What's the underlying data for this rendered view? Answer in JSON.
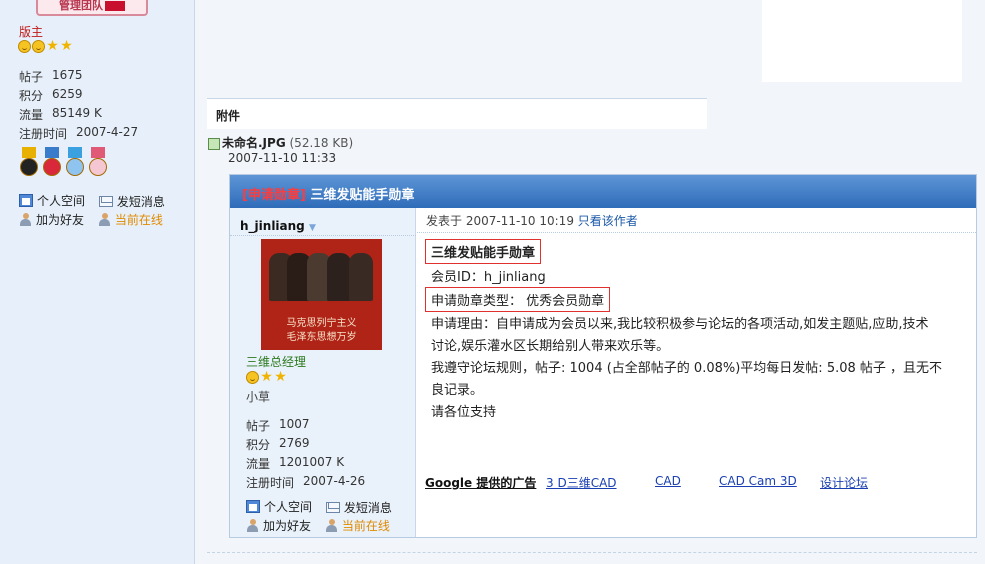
{
  "left_profile": {
    "team_banner": "管理团队",
    "rank": "版主",
    "stats": [
      {
        "label": "帖子",
        "value": "1675"
      },
      {
        "label": "积分",
        "value": "6259"
      },
      {
        "label": "流量",
        "value": "85149 K"
      },
      {
        "label": "注册时间",
        "value": "2007-4-27"
      }
    ],
    "links": {
      "space": "个人空间",
      "message": "发短消息",
      "add_friend": "加为好友",
      "online": "当前在线"
    }
  },
  "attachment": {
    "heading": "附件",
    "file_name": "未命名.JPG",
    "file_size": "(52.18 KB)",
    "file_date": "2007-11-10 11:33"
  },
  "post_image": {
    "title_tag": "[申请勋章]",
    "title": " 三维发贴能手勋章",
    "author": {
      "name": "h_jinliang",
      "avatar_caption_1": "马克思列宁主义",
      "avatar_caption_2": "毛泽东思想万岁",
      "rank": "三维总经理",
      "sub_rank": "小草",
      "stats": [
        {
          "label": "帖子",
          "value": "1007"
        },
        {
          "label": "积分",
          "value": "2769"
        },
        {
          "label": "流量",
          "value": "1201007 K"
        },
        {
          "label": "注册时间",
          "value": "2007-4-26"
        }
      ],
      "links": {
        "space": "个人空间",
        "message": "发短消息",
        "add_friend": "加为好友",
        "online": "当前在线"
      }
    },
    "meta": {
      "posted_at": "发表于 2007-11-10 10:19",
      "only_author": "只看该作者"
    },
    "body": {
      "heading": "三维发贴能手勋章",
      "member_id": "会员ID：h_jinliang",
      "medal_type": "申请勋章类型： 优秀会员勋章",
      "reason_1": "申请理由：自申请成为会员以来,我比较积极参与论坛的各项活动,如发主题贴,应助,技术",
      "reason_2": "讨论,娱乐灌水区长期给别人带来欢乐等。",
      "rules_1": "我遵守论坛规则，帖子: 1004 (占全部帖子的 0.08%)平均每日发帖: 5.08 帖子 ，且无不",
      "rules_2": "良记录。",
      "support": "请各位支持"
    },
    "ads": {
      "label": "Google 提供的广告",
      "links": [
        "3 D三维CAD",
        "CAD",
        "CAD Cam 3D",
        "设计论坛"
      ]
    }
  }
}
